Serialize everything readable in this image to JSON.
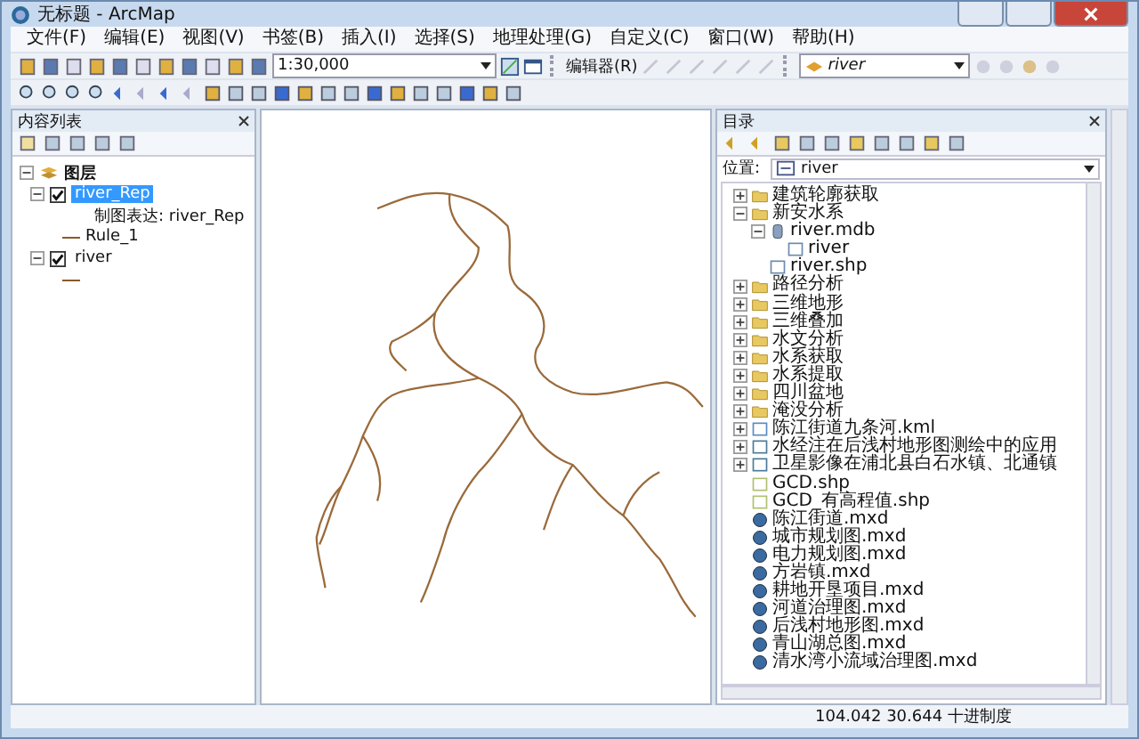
{
  "window": {
    "title": "无标题 - ArcMap"
  },
  "menu": [
    "文件(F)",
    "编辑(E)",
    "视图(V)",
    "书签(B)",
    "插入(I)",
    "选择(S)",
    "地理处理(G)",
    "自定义(C)",
    "窗口(W)",
    "帮助(H)"
  ],
  "toolbar": {
    "scale": "1:30,000",
    "editor": "编辑器(R)",
    "layer": "river"
  },
  "toc": {
    "title": "内容列表",
    "root": "图层",
    "root_expanded": true,
    "layers": [
      {
        "name": "river_Rep",
        "checked": true,
        "selected": true,
        "expanded": true,
        "representation": "制图表达: river_Rep",
        "rule": "Rule_1"
      },
      {
        "name": "river",
        "checked": true,
        "selected": false,
        "expanded": true
      }
    ]
  },
  "catalog": {
    "title": "目录",
    "location_label": "位置:",
    "location": "river",
    "items": [
      {
        "kind": "folder",
        "name": "建筑轮廓获取",
        "expanded": false
      },
      {
        "kind": "folder",
        "name": "新安水系",
        "expanded": true,
        "children": [
          {
            "kind": "mdb",
            "name": "river.mdb",
            "expanded": true,
            "children": [
              {
                "kind": "feature",
                "name": "river"
              }
            ]
          },
          {
            "kind": "feature",
            "name": "river.shp"
          }
        ]
      },
      {
        "kind": "folder",
        "name": "路径分析",
        "expanded": false
      },
      {
        "kind": "folder",
        "name": "三维地形",
        "expanded": false
      },
      {
        "kind": "folder",
        "name": "三维叠加",
        "expanded": false
      },
      {
        "kind": "folder",
        "name": "水文分析",
        "expanded": false
      },
      {
        "kind": "folder",
        "name": "水系获取",
        "expanded": false
      },
      {
        "kind": "folder",
        "name": "水系提取",
        "expanded": false
      },
      {
        "kind": "folder",
        "name": "四川盆地",
        "expanded": false
      },
      {
        "kind": "folder",
        "name": "淹没分析",
        "expanded": false
      },
      {
        "kind": "kml",
        "name": "陈江街道九条河.kml",
        "expanded": false
      },
      {
        "kind": "layer",
        "name": "水经注在后浅村地形图测绘中的应用",
        "expanded": false
      },
      {
        "kind": "layer",
        "name": "卫星影像在浦北县白石水镇、北通镇",
        "expanded": false
      },
      {
        "kind": "shp",
        "name": "GCD.shp"
      },
      {
        "kind": "shp",
        "name": "GCD_有高程值.shp"
      },
      {
        "kind": "mxd",
        "name": "陈江街道.mxd"
      },
      {
        "kind": "mxd",
        "name": "城市规划图.mxd"
      },
      {
        "kind": "mxd",
        "name": "电力规划图.mxd"
      },
      {
        "kind": "mxd",
        "name": "方岩镇.mxd"
      },
      {
        "kind": "mxd",
        "name": "耕地开垦项目.mxd"
      },
      {
        "kind": "mxd",
        "name": "河道治理图.mxd"
      },
      {
        "kind": "mxd",
        "name": "后浅村地形图.mxd"
      },
      {
        "kind": "mxd",
        "name": "青山湖总图.mxd"
      },
      {
        "kind": "mxd",
        "name": "清水湾小流域治理图.mxd"
      }
    ]
  },
  "status_bar": {
    "coordinates": "104.042  30.644 十进制度"
  }
}
